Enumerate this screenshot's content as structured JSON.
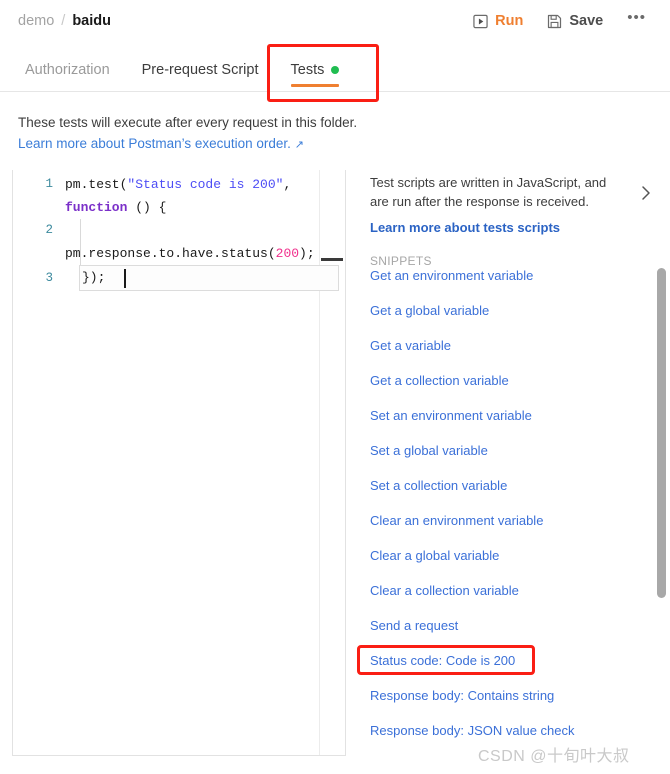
{
  "topbar": {
    "breadcrumb": {
      "parent": "demo",
      "separator": "/",
      "current": "baidu"
    },
    "run_label": "Run",
    "save_label": "Save",
    "more_label": "•••"
  },
  "tabs": [
    {
      "label": "Authorization",
      "active": false,
      "dot": false
    },
    {
      "label": "Pre-request Script",
      "active": false,
      "dot": false
    },
    {
      "label": "Tests",
      "active": true,
      "dot": true
    }
  ],
  "description": {
    "text": "These tests will execute after every request in this folder.",
    "link": "Learn more about Postman’s execution order.",
    "link_arrow": "↗"
  },
  "editor": {
    "line_numbers": [
      "1",
      "2",
      "3"
    ],
    "lines": [
      "pm.test(\"Status code is 200\", function () {",
      "    pm.response.to.have.status(200);",
      "});"
    ],
    "line3_text": "});",
    "line3_number": "3",
    "tokens": {
      "l1_a": "pm.test(",
      "l1_string": "\"Status code is 200\"",
      "l1_comma": ", ",
      "l1_kw": "function",
      "l1_tail": " () {",
      "l2_a": "    pm.response.to.have.status(",
      "l2_num": "200",
      "l2_tail": ");"
    }
  },
  "sidebar": {
    "intro": "Test scripts are written in JavaScript, and are run after the response is received.",
    "intro_link": "Learn more about tests scripts",
    "snippets_label": "SNIPPETS",
    "snippets": [
      {
        "label": "Get an environment variable",
        "highlighted": false
      },
      {
        "label": "Get a global variable",
        "highlighted": false
      },
      {
        "label": "Get a variable",
        "highlighted": false
      },
      {
        "label": "Get a collection variable",
        "highlighted": false
      },
      {
        "label": "Set an environment variable",
        "highlighted": false
      },
      {
        "label": "Set a global variable",
        "highlighted": false
      },
      {
        "label": "Set a collection variable",
        "highlighted": false
      },
      {
        "label": "Clear an environment variable",
        "highlighted": false
      },
      {
        "label": "Clear a global variable",
        "highlighted": false
      },
      {
        "label": "Clear a collection variable",
        "highlighted": false
      },
      {
        "label": "Send a request",
        "highlighted": false
      },
      {
        "label": "Status code: Code is 200",
        "highlighted": true
      },
      {
        "label": "Response body: Contains string",
        "highlighted": false
      },
      {
        "label": "Response body: JSON value check",
        "highlighted": false
      }
    ]
  },
  "watermark": "CSDN @十旬叶大叔",
  "colors": {
    "accent_orange": "#ef7f30",
    "link_blue": "#3b70d8",
    "status_green": "#20bd51",
    "annotation_red": "#fa1e14",
    "code_string": "#4d4df5",
    "code_keyword": "#7b30c9",
    "code_number": "#f0308c",
    "gutter": "#3d8a9e"
  }
}
